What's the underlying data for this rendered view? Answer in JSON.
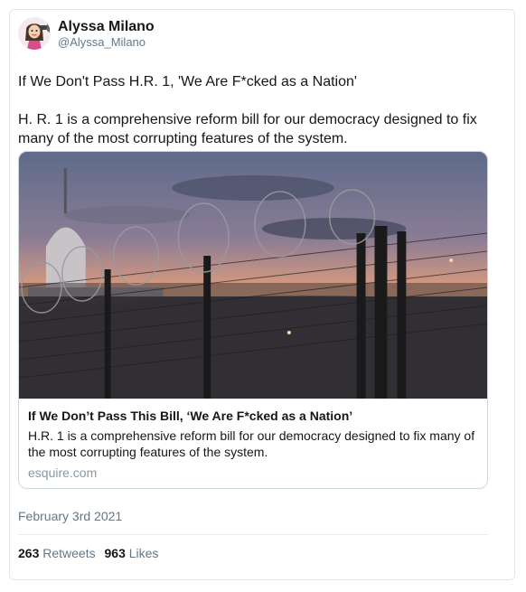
{
  "user": {
    "name": "Alyssa Milano",
    "handle": "@Alyssa_Milano",
    "avatar_icon": "cartoon-avatar-icon"
  },
  "tweet": {
    "line1": "If We Don't Pass H.R. 1, 'We Are F*cked as a Nation'",
    "line2": "H. R. 1 is a comprehensive reform bill for our democracy designed to fix many of the most corrupting features of the system."
  },
  "link_card": {
    "image_icon": "capitol-fence-photo",
    "title": "If We Don’t Pass This Bill, ‘We Are F*cked as a Nation’",
    "description": "H.R. 1 is a comprehensive reform bill for our democracy designed to fix many of the most corrupting features of the system.",
    "domain": "esquire.com"
  },
  "date": "February 3rd 2021",
  "stats": {
    "retweets_count": "263",
    "retweets_label": "Retweets",
    "likes_count": "963",
    "likes_label": "Likes"
  }
}
